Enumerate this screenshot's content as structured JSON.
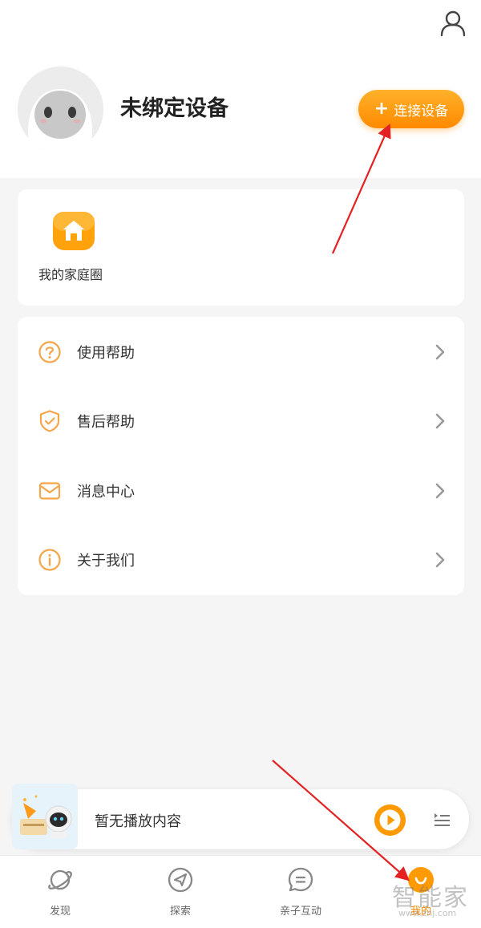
{
  "header": {
    "device_title": "未绑定设备",
    "connect_button": "连接设备",
    "connect_plus": "+"
  },
  "family": {
    "label": "我的家庭圈"
  },
  "menu": {
    "items": [
      {
        "label": "使用帮助",
        "icon": "question-circle-icon"
      },
      {
        "label": "售后帮助",
        "icon": "shield-check-icon"
      },
      {
        "label": "消息中心",
        "icon": "envelope-icon"
      },
      {
        "label": "关于我们",
        "icon": "info-circle-icon"
      }
    ]
  },
  "player": {
    "status": "暂无播放内容"
  },
  "tabs": [
    {
      "label": "发现",
      "icon": "planet-icon"
    },
    {
      "label": "探索",
      "icon": "compass-icon"
    },
    {
      "label": "亲子互动",
      "icon": "chat-bubble-icon"
    },
    {
      "label": "我的",
      "icon": "robot-face-icon",
      "active": true
    }
  ],
  "watermark": {
    "text": "智能家",
    "url": "www.znj.com"
  },
  "colors": {
    "accent": "#ff8a00",
    "accent_light": "#ffb12a",
    "icon_orange": "#f5a54a",
    "annotation_red": "#e52222"
  }
}
